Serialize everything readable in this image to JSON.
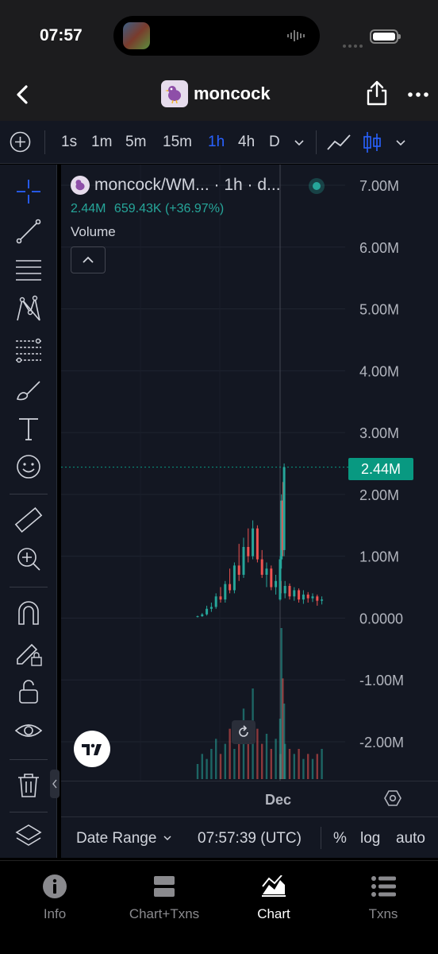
{
  "status_bar": {
    "time": "07:57"
  },
  "header": {
    "title": "moncock",
    "back_icon": "chevron-left-icon",
    "share_icon": "share-icon",
    "more_icon": "ellipsis-icon"
  },
  "timeframes": {
    "items": [
      "1s",
      "1m",
      "5m",
      "15m",
      "1h",
      "4h",
      "D"
    ],
    "active": "1h"
  },
  "drawing_tools": [
    "crosshair-icon",
    "trend-line-icon",
    "horizontal-lines-icon",
    "pattern-icon",
    "fib-retracement-icon",
    "brush-icon",
    "text-icon",
    "emoji-icon",
    "ruler-icon",
    "zoom-in-icon",
    "magnet-icon",
    "lock-drawings-icon",
    "unlock-icon",
    "eye-icon",
    "trash-icon",
    "layers-icon"
  ],
  "legend": {
    "symbol": "moncock/WM...",
    "interval": "· 1h · d...",
    "last_value": "2.44M",
    "change": "659.43K (+36.97%)",
    "volume_label": "Volume"
  },
  "colors": {
    "up": "#26a69a",
    "down": "#ef5350",
    "accent": "#2962ff",
    "background": "#131722"
  },
  "chart_data": {
    "type": "candlestick",
    "symbol": "moncock/WM...",
    "interval": "1h",
    "y_axis_ticks": [
      "7.00M",
      "6.00M",
      "5.00M",
      "4.00M",
      "3.00M",
      "2.00M",
      "1.00M",
      "0.0000",
      "-1.00M",
      "-2.00M"
    ],
    "y_axis_values": [
      7000000,
      6000000,
      5000000,
      4000000,
      3000000,
      2000000,
      1000000,
      0,
      -1000000,
      -2000000
    ],
    "ylim": [
      -2600000,
      7300000
    ],
    "current_price": 2440000,
    "current_price_label": "2.44M",
    "x_axis_label": "Dec",
    "grid": true,
    "series": [
      {
        "ohlc": [
          [
            20000,
            40000,
            10000,
            30000
          ],
          [
            30000,
            80000,
            20000,
            60000
          ],
          [
            60000,
            200000,
            40000,
            150000
          ],
          [
            150000,
            250000,
            100000,
            180000
          ],
          [
            180000,
            400000,
            150000,
            350000
          ],
          [
            350000,
            500000,
            250000,
            300000
          ],
          [
            300000,
            600000,
            250000,
            550000
          ],
          [
            550000,
            800000,
            400000,
            450000
          ],
          [
            450000,
            900000,
            400000,
            850000
          ],
          [
            850000,
            1200000,
            600000,
            700000
          ],
          [
            700000,
            1300000,
            650000,
            1150000
          ],
          [
            1150000,
            1450000,
            900000,
            1000000
          ],
          [
            1000000,
            1580000,
            950000,
            1450000
          ],
          [
            1450000,
            1500000,
            900000,
            950000
          ],
          [
            950000,
            1100000,
            650000,
            700000
          ],
          [
            700000,
            900000,
            500000,
            800000
          ],
          [
            800000,
            850000,
            450000,
            500000
          ],
          [
            500000,
            700000,
            380000,
            600000
          ],
          [
            600000,
            650000,
            350000,
            400000
          ],
          [
            400000,
            600000,
            320000,
            520000
          ],
          [
            520000,
            560000,
            300000,
            350000
          ],
          [
            350000,
            500000,
            280000,
            450000
          ],
          [
            450000,
            480000,
            250000,
            300000
          ],
          [
            300000,
            450000,
            230000,
            380000
          ],
          [
            380000,
            420000,
            250000,
            320000
          ],
          [
            320000,
            400000,
            260000,
            350000
          ],
          [
            350000,
            380000,
            200000,
            280000
          ],
          [
            280000,
            350000,
            220000,
            300000
          ],
          [
            300000,
            1000000,
            280000,
            950000
          ],
          [
            950000,
            2000000,
            800000,
            1900000
          ],
          [
            1900000,
            2200000,
            1000000,
            1100000
          ],
          [
            1100000,
            2500000,
            1000000,
            2440000
          ]
        ]
      }
    ],
    "volume": [
      3,
      5,
      4,
      6,
      8,
      5,
      7,
      10,
      6,
      9,
      14,
      8,
      18,
      10,
      7,
      9,
      6,
      8,
      5,
      7,
      6,
      5,
      6,
      4,
      5,
      4,
      5,
      6,
      12,
      30,
      20,
      15
    ]
  },
  "bottom_toolbar": {
    "date_range": "Date Range",
    "time": "07:57:39 (UTC)",
    "percent": "%",
    "log": "log",
    "auto": "auto"
  },
  "tabs": [
    {
      "label": "Info",
      "icon": "info-icon"
    },
    {
      "label": "Chart+Txns",
      "icon": "split-view-icon"
    },
    {
      "label": "Chart",
      "icon": "chart-area-icon",
      "active": true
    },
    {
      "label": "Txns",
      "icon": "list-icon"
    }
  ]
}
